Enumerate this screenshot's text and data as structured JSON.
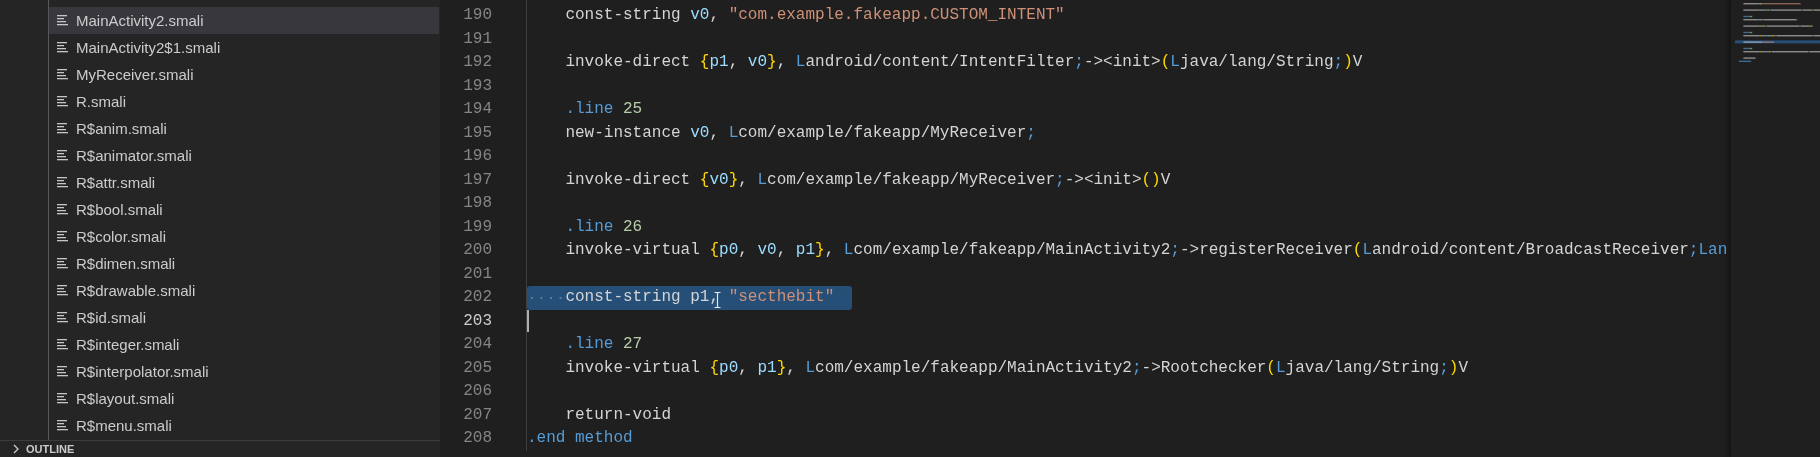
{
  "sidebar": {
    "items": [
      {
        "label": "MainActivity2.smali",
        "selected": true
      },
      {
        "label": "MainActivity2$1.smali",
        "selected": false
      },
      {
        "label": "MyReceiver.smali",
        "selected": false
      },
      {
        "label": "R.smali",
        "selected": false
      },
      {
        "label": "R$anim.smali",
        "selected": false
      },
      {
        "label": "R$animator.smali",
        "selected": false
      },
      {
        "label": "R$attr.smali",
        "selected": false
      },
      {
        "label": "R$bool.smali",
        "selected": false
      },
      {
        "label": "R$color.smali",
        "selected": false
      },
      {
        "label": "R$dimen.smali",
        "selected": false
      },
      {
        "label": "R$drawable.smali",
        "selected": false
      },
      {
        "label": "R$id.smali",
        "selected": false
      },
      {
        "label": "R$integer.smali",
        "selected": false
      },
      {
        "label": "R$interpolator.smali",
        "selected": false
      },
      {
        "label": "R$layout.smali",
        "selected": false
      },
      {
        "label": "R$menu.smali",
        "selected": false
      }
    ],
    "outline": {
      "label": "OUTLINE",
      "expanded": false
    }
  },
  "editor": {
    "lines": [
      {
        "number": "190",
        "selected": false,
        "current": false,
        "indent": true,
        "tokens": [
          {
            "kind": "plain",
            "text": "const-string "
          },
          {
            "kind": "reg",
            "text": "v0"
          },
          {
            "kind": "plain",
            "text": ", "
          },
          {
            "kind": "str",
            "text": "\"com.example.fakeapp.CUSTOM_INTENT\""
          }
        ]
      },
      {
        "number": "191",
        "selected": false,
        "current": false
      },
      {
        "number": "192",
        "selected": false,
        "current": false,
        "indent": true,
        "tokens": [
          {
            "kind": "plain",
            "text": "invoke-direct "
          },
          {
            "kind": "brace",
            "text": "{"
          },
          {
            "kind": "reg",
            "text": "p1"
          },
          {
            "kind": "plain",
            "text": ", "
          },
          {
            "kind": "reg",
            "text": "v0"
          },
          {
            "kind": "brace",
            "text": "}"
          },
          {
            "kind": "plain",
            "text": ", "
          },
          {
            "kind": "cls",
            "text": "L"
          },
          {
            "kind": "plain",
            "text": "android/content/IntentFilter"
          },
          {
            "kind": "cls",
            "text": ";"
          },
          {
            "kind": "plain",
            "text": "-><init>"
          },
          {
            "kind": "brace",
            "text": "("
          },
          {
            "kind": "cls",
            "text": "L"
          },
          {
            "kind": "plain",
            "text": "java/lang/String"
          },
          {
            "kind": "cls",
            "text": ";"
          },
          {
            "kind": "brace",
            "text": ")"
          },
          {
            "kind": "plain",
            "text": "V"
          }
        ]
      },
      {
        "number": "193",
        "selected": false,
        "current": false
      },
      {
        "number": "194",
        "selected": false,
        "current": false,
        "indent": true,
        "tokens": [
          {
            "kind": "dir",
            "text": ".line "
          },
          {
            "kind": "num",
            "text": "25"
          }
        ]
      },
      {
        "number": "195",
        "selected": false,
        "current": false,
        "indent": true,
        "tokens": [
          {
            "kind": "plain",
            "text": "new-instance "
          },
          {
            "kind": "reg",
            "text": "v0"
          },
          {
            "kind": "plain",
            "text": ", "
          },
          {
            "kind": "cls",
            "text": "L"
          },
          {
            "kind": "plain",
            "text": "com/example/fakeapp/MyReceiver"
          },
          {
            "kind": "cls",
            "text": ";"
          }
        ]
      },
      {
        "number": "196",
        "selected": false,
        "current": false
      },
      {
        "number": "197",
        "selected": false,
        "current": false,
        "indent": true,
        "tokens": [
          {
            "kind": "plain",
            "text": "invoke-direct "
          },
          {
            "kind": "brace",
            "text": "{"
          },
          {
            "kind": "reg",
            "text": "v0"
          },
          {
            "kind": "brace",
            "text": "}"
          },
          {
            "kind": "plain",
            "text": ", "
          },
          {
            "kind": "cls",
            "text": "L"
          },
          {
            "kind": "plain",
            "text": "com/example/fakeapp/MyReceiver"
          },
          {
            "kind": "cls",
            "text": ";"
          },
          {
            "kind": "plain",
            "text": "-><init>"
          },
          {
            "kind": "brace",
            "text": "()"
          },
          {
            "kind": "plain",
            "text": "V"
          }
        ]
      },
      {
        "number": "198",
        "selected": false,
        "current": false
      },
      {
        "number": "199",
        "selected": false,
        "current": false,
        "indent": true,
        "tokens": [
          {
            "kind": "dir",
            "text": ".line "
          },
          {
            "kind": "num",
            "text": "26"
          }
        ]
      },
      {
        "number": "200",
        "selected": false,
        "current": false,
        "indent": true,
        "tokens": [
          {
            "kind": "plain",
            "text": "invoke-virtual "
          },
          {
            "kind": "brace",
            "text": "{"
          },
          {
            "kind": "reg",
            "text": "p0"
          },
          {
            "kind": "plain",
            "text": ", "
          },
          {
            "kind": "reg",
            "text": "v0"
          },
          {
            "kind": "plain",
            "text": ", "
          },
          {
            "kind": "reg",
            "text": "p1"
          },
          {
            "kind": "brace",
            "text": "}"
          },
          {
            "kind": "plain",
            "text": ", "
          },
          {
            "kind": "cls",
            "text": "L"
          },
          {
            "kind": "plain",
            "text": "com/example/fakeapp/MainActivity2"
          },
          {
            "kind": "cls",
            "text": ";"
          },
          {
            "kind": "plain",
            "text": "->registerReceiver"
          },
          {
            "kind": "brace",
            "text": "("
          },
          {
            "kind": "cls",
            "text": "L"
          },
          {
            "kind": "plain",
            "text": "android/content/BroadcastReceiver"
          },
          {
            "kind": "cls",
            "text": ";Lan"
          }
        ]
      },
      {
        "number": "201",
        "selected": false,
        "current": false
      },
      {
        "number": "202",
        "selected": true,
        "current": false,
        "indent": true,
        "tokens": [
          {
            "kind": "plain",
            "text": "const-string p1, "
          },
          {
            "kind": "str",
            "text": "\"secthebit\""
          }
        ]
      },
      {
        "number": "203",
        "selected": false,
        "current": true
      },
      {
        "number": "204",
        "selected": false,
        "current": false,
        "indent": true,
        "tokens": [
          {
            "kind": "dir",
            "text": ".line "
          },
          {
            "kind": "num",
            "text": "27"
          }
        ]
      },
      {
        "number": "205",
        "selected": false,
        "current": false,
        "indent": true,
        "tokens": [
          {
            "kind": "plain",
            "text": "invoke-virtual "
          },
          {
            "kind": "brace",
            "text": "{"
          },
          {
            "kind": "reg",
            "text": "p0"
          },
          {
            "kind": "plain",
            "text": ", "
          },
          {
            "kind": "reg",
            "text": "p1"
          },
          {
            "kind": "brace",
            "text": "}"
          },
          {
            "kind": "plain",
            "text": ", "
          },
          {
            "kind": "cls",
            "text": "L"
          },
          {
            "kind": "plain",
            "text": "com/example/fakeapp/MainActivity2"
          },
          {
            "kind": "cls",
            "text": ";"
          },
          {
            "kind": "plain",
            "text": "->Rootchecker"
          },
          {
            "kind": "brace",
            "text": "("
          },
          {
            "kind": "cls",
            "text": "L"
          },
          {
            "kind": "plain",
            "text": "java/lang/String"
          },
          {
            "kind": "cls",
            "text": ";"
          },
          {
            "kind": "brace",
            "text": ")"
          },
          {
            "kind": "plain",
            "text": "V"
          }
        ]
      },
      {
        "number": "206",
        "selected": false,
        "current": false
      },
      {
        "number": "207",
        "selected": false,
        "current": false,
        "indent": true,
        "tokens": [
          {
            "kind": "plain",
            "text": "return-void"
          }
        ]
      },
      {
        "number": "208",
        "selected": false,
        "current": false,
        "tokens": [
          {
            "kind": "dir",
            "text": ".end method"
          }
        ]
      }
    ]
  }
}
